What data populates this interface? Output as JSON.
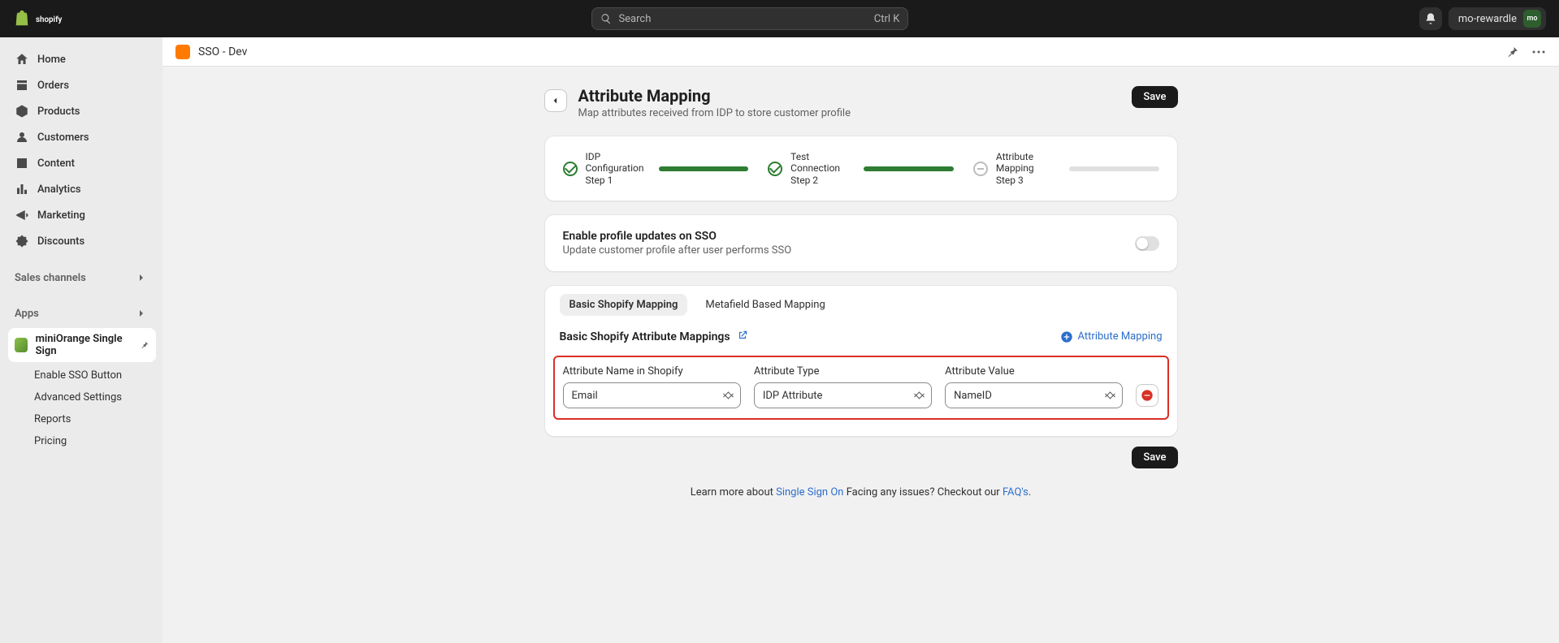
{
  "topbar": {
    "search_placeholder": "Search",
    "shortcut": "Ctrl K",
    "store_name": "mo-rewardle",
    "avatar_initials": "mo"
  },
  "sidebar": {
    "items": [
      {
        "label": "Home"
      },
      {
        "label": "Orders"
      },
      {
        "label": "Products"
      },
      {
        "label": "Customers"
      },
      {
        "label": "Content"
      },
      {
        "label": "Analytics"
      },
      {
        "label": "Marketing"
      },
      {
        "label": "Discounts"
      }
    ],
    "sales_channels": "Sales channels",
    "apps": "Apps",
    "app_name": "miniOrange Single Sign",
    "sub_items": [
      {
        "label": "Enable SSO Button"
      },
      {
        "label": "Advanced Settings"
      },
      {
        "label": "Reports"
      },
      {
        "label": "Pricing"
      }
    ]
  },
  "app_header": {
    "title": "SSO - Dev"
  },
  "page": {
    "title": "Attribute Mapping",
    "subtitle": "Map attributes received from IDP to store customer profile",
    "save": "Save"
  },
  "steps": [
    {
      "line1": "IDP",
      "line2": "Configuration",
      "line3": "Step 1",
      "status": "done"
    },
    {
      "line1": "Test",
      "line2": "Connection",
      "line3": "Step 2",
      "status": "done"
    },
    {
      "line1": "Attribute",
      "line2": "Mapping",
      "line3": "Step 3",
      "status": "pending"
    }
  ],
  "toggle_card": {
    "title": "Enable profile updates on SSO",
    "subtitle": "Update customer profile after user performs SSO"
  },
  "mapping": {
    "tabs": [
      {
        "label": "Basic Shopify Mapping",
        "active": true
      },
      {
        "label": "Metafield Based Mapping",
        "active": false
      }
    ],
    "section_title": "Basic Shopify Attribute Mappings",
    "add_link": "Attribute Mapping",
    "fields": {
      "name_label": "Attribute Name in Shopify",
      "name_value": "Email",
      "type_label": "Attribute Type",
      "type_value": "IDP Attribute",
      "value_label": "Attribute Value",
      "value_value": "NameID"
    }
  },
  "footer": {
    "learn_prefix": "Learn more about ",
    "learn_link": "Single Sign On",
    "learn_mid": " Facing any issues? Checkout our ",
    "faq_link": "FAQ's",
    "learn_suffix": "."
  }
}
